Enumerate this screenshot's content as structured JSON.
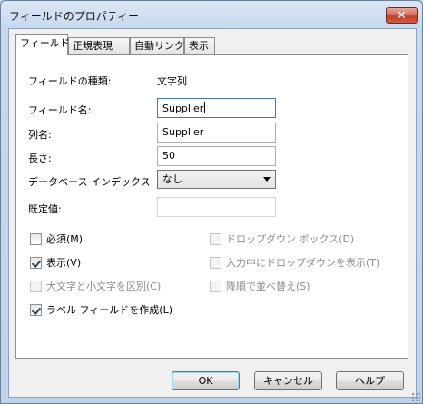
{
  "window": {
    "title": "フィールドのプロパティー",
    "close_glyph": "✕"
  },
  "tabs": [
    {
      "label": "フィールド",
      "active": true
    },
    {
      "label": "正規表現",
      "active": false
    },
    {
      "label": "自動リンク",
      "active": false
    },
    {
      "label": "表示",
      "active": false
    }
  ],
  "fields": {
    "type_label": "フィールドの種類:",
    "type_value": "文字列",
    "name_label": "フィールド名:",
    "name_value": "Supplier",
    "column_label": "列名:",
    "column_value": "Supplier",
    "length_label": "長さ:",
    "length_value": "50",
    "index_label": "データベース インデックス:",
    "index_value": "なし",
    "default_label": "既定値:",
    "default_value": ""
  },
  "checkboxes": {
    "required": {
      "label": "必須(M)",
      "checked": false,
      "enabled": true
    },
    "visible": {
      "label": "表示(V)",
      "checked": true,
      "enabled": true
    },
    "case_sensitive": {
      "label": "大文字と小文字を区別(C)",
      "checked": false,
      "enabled": false
    },
    "create_label_field": {
      "label": "ラベル フィールドを作成(L)",
      "checked": true,
      "enabled": true
    },
    "dropdown_box": {
      "label": "ドロップダウン ボックス(D)",
      "checked": false,
      "enabled": false
    },
    "show_dropdown_typing": {
      "label": "入力中にドロップダウンを表示(T)",
      "checked": false,
      "enabled": false
    },
    "sort_descending": {
      "label": "降順で並べ替え(S)",
      "checked": false,
      "enabled": false
    }
  },
  "buttons": {
    "ok": "OK",
    "cancel": "キャンセル",
    "help": "ヘルプ"
  }
}
